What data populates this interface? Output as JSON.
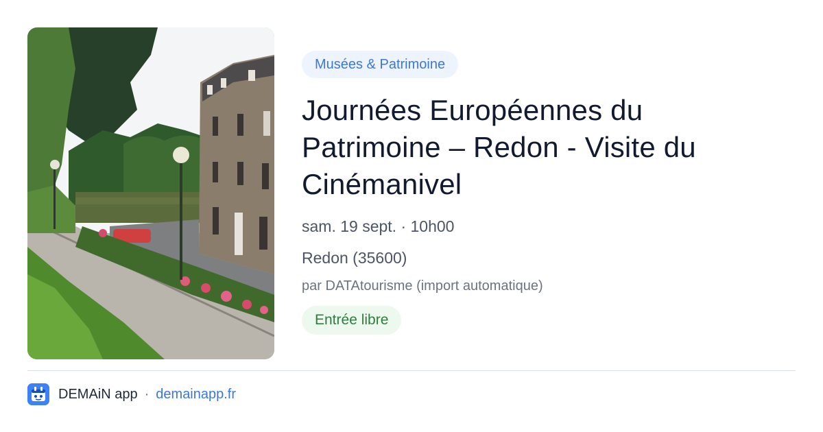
{
  "event": {
    "category": "Musées & Patrimoine",
    "title": "Journées Européennes du Patrimoine – Redon - Visite du Cinémanivel",
    "date_time": "sam. 19 sept. · 10h00",
    "location": "Redon (35600)",
    "organizer": "par DATAtourisme (import automatique)",
    "price": "Entrée libre"
  },
  "footer": {
    "app_name": "DEMAiN app",
    "separator": "·",
    "url": "demainapp.fr"
  },
  "colors": {
    "category_badge_bg": "#eef4fd",
    "category_badge_text": "#3b78d6",
    "price_badge_bg": "#edf8ef",
    "price_badge_text": "#2e7d3e",
    "link": "#3b78d6",
    "logo": "#3b82f6"
  },
  "icons": {
    "app_logo": "demain-app-logo-icon"
  }
}
